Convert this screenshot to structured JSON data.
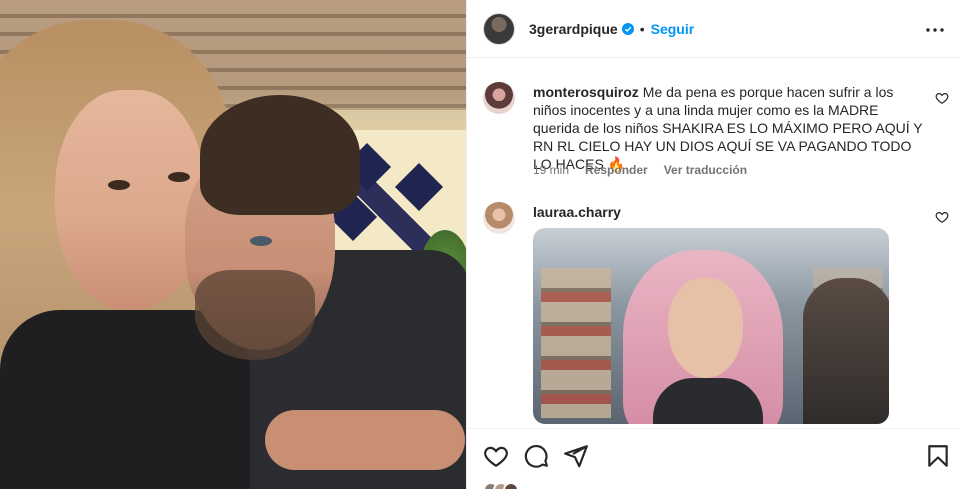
{
  "post": {
    "owner_username": "3gerardpique",
    "separator": "•",
    "follow_label": "Seguir",
    "more_icon": "more-options-icon",
    "verified_color": "#0095f6"
  },
  "comments": [
    {
      "username": "monterosquiroz",
      "text": "Me da pena es porque hacen sufrir a los niños inocentes y a una linda mujer como es la MADRE querida de los niños SHAKIRA ES LO MÁXIMO PERO AQUÍ Y RN RL CIELO HAY UN DIOS AQUÍ SE VA PAGANDO TODO LO HACES",
      "emoji": "🔥",
      "time": "19 min",
      "reply_label": "Responder",
      "translate_label": "Ver traducción"
    },
    {
      "username": "lauraa.charry",
      "text": ""
    }
  ],
  "action_bar": {
    "icons": [
      "heart-icon",
      "comment-icon",
      "share-icon",
      "bookmark-icon"
    ]
  }
}
